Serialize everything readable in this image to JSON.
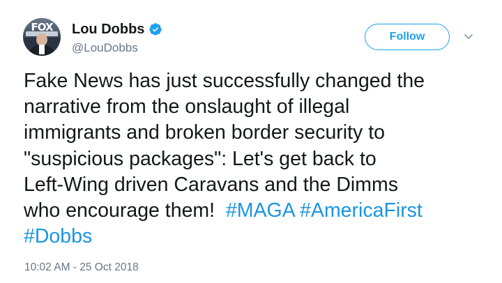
{
  "author": {
    "display_name": "Lou Dobbs",
    "handle": "@LouDobbs",
    "verified": true,
    "avatar_logo_text": "FOX"
  },
  "actions": {
    "follow_label": "Follow"
  },
  "tweet": {
    "text_lines": [
      "Fake News has just successfully changed the",
      "narrative from the onslaught of illegal",
      "immigrants and broken border security to",
      "\"suspicious packages\": Let's get back to",
      "Left-Wing driven Caravans and the Dimms",
      "who encourage them!  "
    ],
    "hashtags": [
      "#MAGA",
      "#AmericaFirst",
      "#Dobbs"
    ],
    "timestamp": "10:02 AM - 25 Oct 2018"
  },
  "colors": {
    "accent": "#1da1f2",
    "hashtag": "#1b95e0",
    "text": "#14171a",
    "secondary_text": "#657786"
  },
  "icons": {
    "verified": "verified-badge-icon",
    "menu": "chevron-down-icon"
  }
}
